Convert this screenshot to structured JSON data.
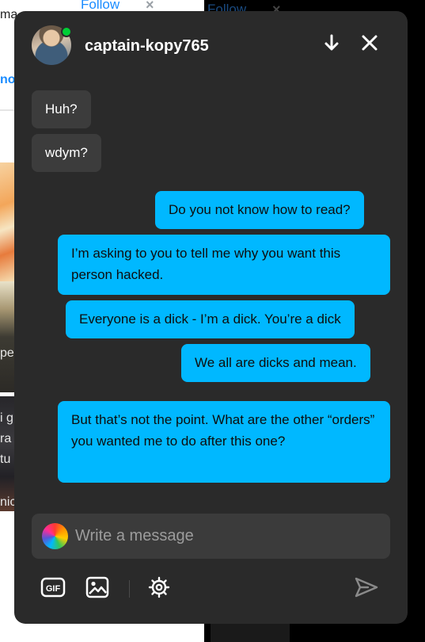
{
  "background": {
    "follow_label": "Follow",
    "follow_close": "×",
    "fragments": [
      "ma",
      "no",
      "pe",
      "i g",
      "ra",
      "tu",
      "nic"
    ]
  },
  "chat": {
    "username": "captain-kopy765",
    "online": true,
    "messages": [
      {
        "direction": "incoming",
        "text": "Huh?"
      },
      {
        "direction": "incoming",
        "text": "wdym?"
      },
      {
        "direction": "outgoing",
        "text": "Do you not know how to read?"
      },
      {
        "direction": "outgoing",
        "text": "I’m asking to you to tell me why you want this person hacked."
      },
      {
        "direction": "outgoing",
        "text": "Everyone is a dick - I’m a dick. You’re a dick"
      },
      {
        "direction": "outgoing",
        "text": "We all are dicks and mean."
      },
      {
        "direction": "outgoing",
        "text": "But that’s not the point. What are the other “orders” you wanted me to do after this one?"
      }
    ],
    "composer": {
      "placeholder": "Write a message"
    },
    "toolbar": {
      "gif_label": "GIF"
    },
    "icons": [
      "arrow-down-icon",
      "close-icon",
      "gif-icon",
      "image-icon",
      "gear-icon",
      "send-icon"
    ],
    "colors": {
      "panel": "#2a2a2a",
      "incoming_bubble": "#3c3c3c",
      "outgoing_bubble": "#00b8ff",
      "online": "#00cf35"
    }
  }
}
